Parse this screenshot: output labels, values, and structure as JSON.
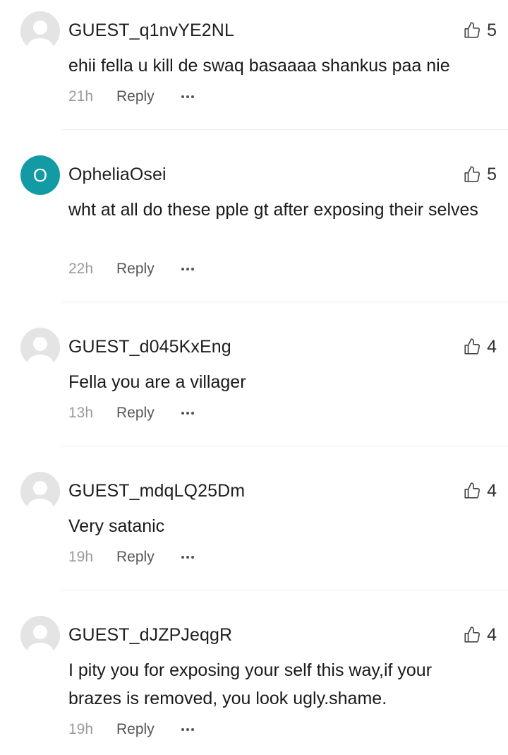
{
  "comments": [
    {
      "avatar": "default-user-avatar",
      "username": "GUEST_q1nvYE2NL",
      "likes": "5",
      "text": "ehii fella u kill de swaq basaaaa shankus paa nie",
      "time": "21h",
      "reply_label": "Reply"
    },
    {
      "avatar": "initial",
      "avatar_initial": "O",
      "avatar_color": "#129aa5",
      "username": "OpheliaOsei",
      "likes": "5",
      "text": "wht at all do these pple gt after exposing their selves",
      "time": "22h",
      "reply_label": "Reply"
    },
    {
      "avatar": "default-user-avatar",
      "username": "GUEST_d045KxEng",
      "likes": "4",
      "text": "Fella you are a villager",
      "time": "13h",
      "reply_label": "Reply"
    },
    {
      "avatar": "default-user-avatar",
      "username": "GUEST_mdqLQ25Dm",
      "likes": "4",
      "text": "Very satanic",
      "time": "19h",
      "reply_label": "Reply"
    },
    {
      "avatar": "default-user-avatar",
      "username": "GUEST_dJZPJeqgR",
      "likes": "4",
      "text": "I pity you for exposing your self this way,if your brazes is removed, you look ugly.shame.",
      "time": "19h",
      "reply_label": "Reply"
    }
  ],
  "icons": {
    "like": "thumbs-up-outline-icon",
    "more": "more-dots-icon"
  },
  "colors": {
    "meta_gray": "#9a9a9a",
    "divider": "#ececec"
  }
}
